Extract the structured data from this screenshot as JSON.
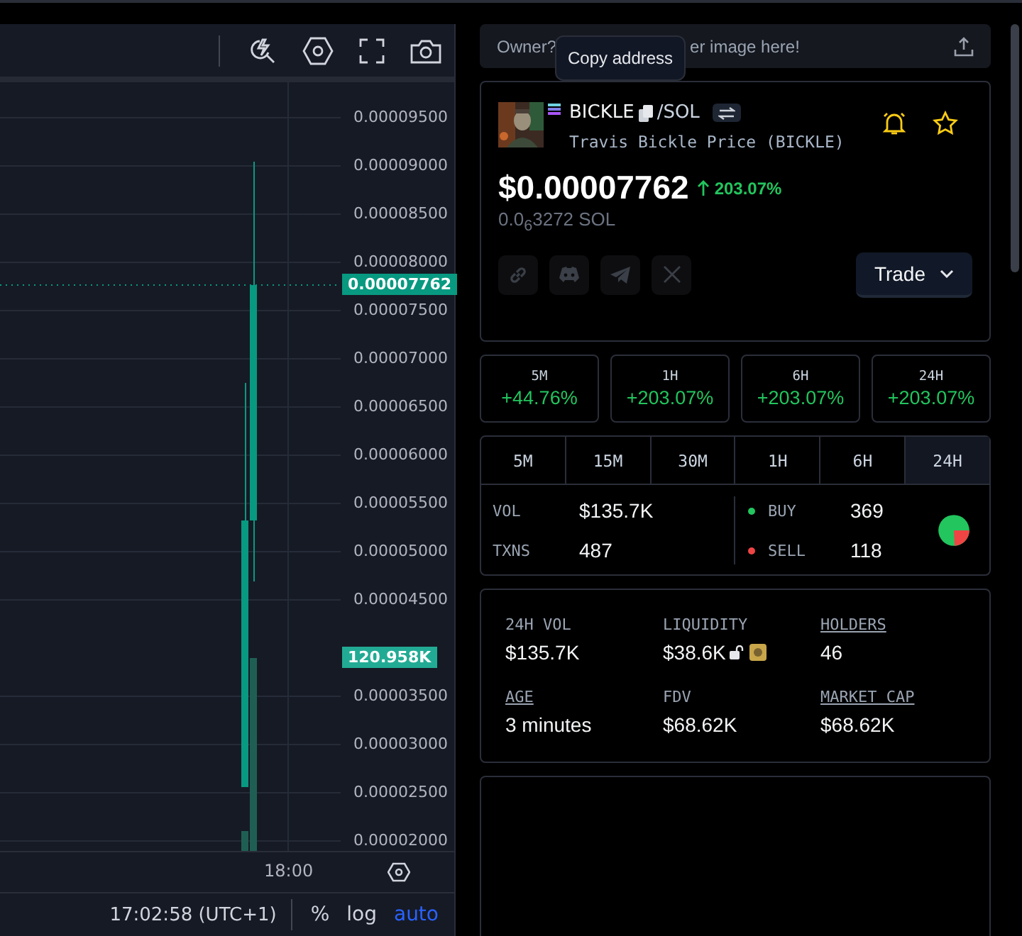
{
  "chart": {
    "y_axis": [
      "0.00009500",
      "0.00009000",
      "0.00008500",
      "0.00008000",
      "0.00007500",
      "0.00007000",
      "0.00006500",
      "0.00006000",
      "0.00005500",
      "0.00005000",
      "0.00004500",
      "0.00003500",
      "0.00003000",
      "0.00002500",
      "0.00002000"
    ],
    "price_badge": "0.00007762",
    "volume_badge": "120.958K",
    "x_label": "18:00",
    "clock": "17:02:58 (UTC+1)",
    "scale_buttons": [
      {
        "label": "%",
        "selected": false
      },
      {
        "label": "log",
        "selected": false
      },
      {
        "label": "auto",
        "selected": true
      }
    ]
  },
  "banner": {
    "text_start": "Owner?",
    "text_end": "er image here!"
  },
  "tooltip": "Copy address",
  "token": {
    "symbol": "BICKLE",
    "quote": "/SOL",
    "name": "Travis Bickle Price (BICKLE)",
    "price": "$0.00007762",
    "change": "203.07%",
    "price_native": "0.0$_{6}$3272 SOL",
    "trade_button": "Trade"
  },
  "changes": [
    {
      "period": "5M",
      "value": "+44.76%"
    },
    {
      "period": "1H",
      "value": "+203.07%"
    },
    {
      "period": "6H",
      "value": "+203.07%"
    },
    {
      "period": "24H",
      "value": "+203.07%"
    }
  ],
  "period_tabs": [
    {
      "label": "5M",
      "selected": false
    },
    {
      "label": "15M",
      "selected": false
    },
    {
      "label": "30M",
      "selected": false
    },
    {
      "label": "1H",
      "selected": false
    },
    {
      "label": "6H",
      "selected": false
    },
    {
      "label": "24H",
      "selected": true
    }
  ],
  "activity": {
    "vol_label": "VOL",
    "vol": "$135.7K",
    "txns_label": "TXNS",
    "txns": "487",
    "buy_label": "BUY",
    "buys": "369",
    "sell_label": "SELL",
    "sells": "118"
  },
  "stats": [
    {
      "label": "24H VOL",
      "value": "$135.7K",
      "kind": "plain"
    },
    {
      "label": "LIQUIDITY",
      "value": "$38.6K",
      "kind": "liquidity"
    },
    {
      "label": "HOLDERS",
      "value": "46",
      "kind": "link"
    },
    {
      "label": "AGE",
      "value": "3 minutes",
      "kind": "link"
    },
    {
      "label": "FDV",
      "value": "$68.62K",
      "kind": "plain"
    },
    {
      "label": "MARKET CAP",
      "value": "$68.62K",
      "kind": "link"
    }
  ]
}
